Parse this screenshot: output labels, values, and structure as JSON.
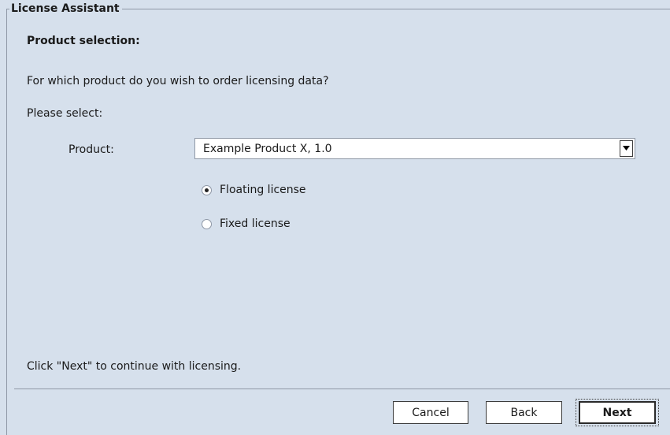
{
  "group": {
    "title": "License Assistant"
  },
  "section": {
    "title": "Product selection:"
  },
  "question": "For which product do you wish to order licensing data?",
  "please_select": "Please select:",
  "product": {
    "label": "Product:",
    "selected": "Example Product X, 1.0"
  },
  "license_options": [
    {
      "label": "Floating license",
      "checked": true
    },
    {
      "label": "Fixed license",
      "checked": false
    }
  ],
  "footer_text": "Click \"Next\" to continue with licensing.",
  "buttons": {
    "cancel": "Cancel",
    "back": "Back",
    "next": "Next"
  }
}
